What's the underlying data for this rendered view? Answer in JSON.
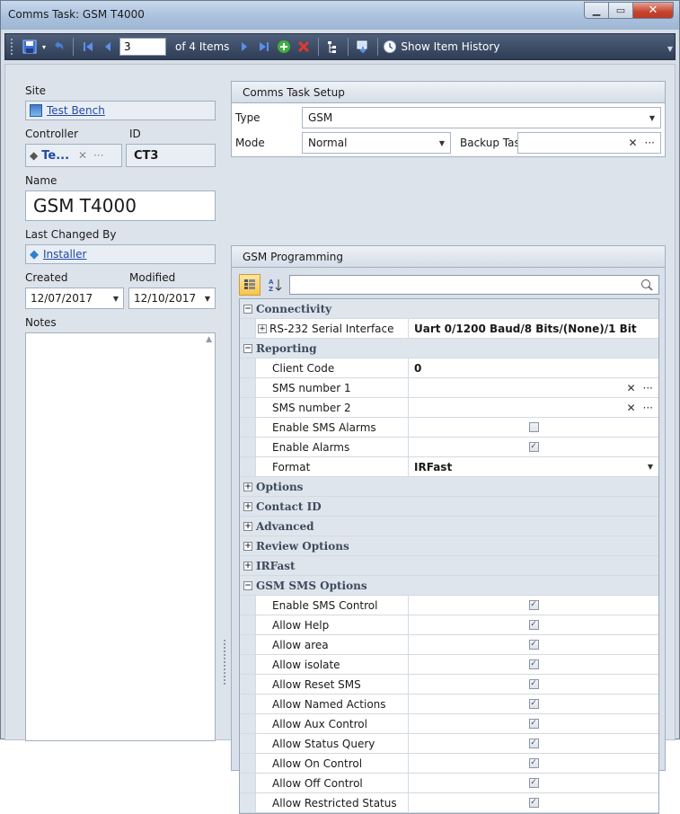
{
  "window": {
    "title": "Comms Task: GSM T4000",
    "controls": {
      "minimize": "▁",
      "maximize": "▭",
      "close": "✕"
    }
  },
  "toolbar": {
    "current_item": "3",
    "items_label": "of 4 Items",
    "history_label": "Show Item History",
    "icons": [
      "save-icon",
      "undo-icon",
      "first-icon",
      "prev-icon",
      "next-icon",
      "last-icon",
      "add-icon",
      "delete-icon",
      "tree-icon",
      "export-icon",
      "history-icon"
    ]
  },
  "left": {
    "site_label": "Site",
    "site_value": "Test Bench",
    "controller_label": "Controller",
    "controller_value": "Te...",
    "id_label": "ID",
    "id_value": "CT3",
    "name_label": "Name",
    "name_value": "GSM T4000",
    "last_changed_label": "Last Changed By",
    "last_changed_value": "Installer",
    "created_label": "Created",
    "created_value": "12/07/2017",
    "modified_label": "Modified",
    "modified_value": "12/10/2017",
    "notes_label": "Notes"
  },
  "setup": {
    "header": "Comms Task Setup",
    "type_label": "Type",
    "type_value": "GSM",
    "mode_label": "Mode",
    "mode_value": "Normal",
    "backup_label": "Backup Task",
    "backup_value": ""
  },
  "gsm": {
    "header": "GSM Programming",
    "cat_connectivity": "Connectivity",
    "rs232_name": "RS-232 Serial Interface",
    "rs232_value": "Uart 0/1200 Baud/8 Bits/(None)/1 Bit",
    "cat_reporting": "Reporting",
    "client_code_name": "Client Code",
    "client_code_value": "0",
    "sms1_name": "SMS number 1",
    "sms2_name": "SMS number 2",
    "enable_sms_alarms_name": "Enable SMS Alarms",
    "enable_alarms_name": "Enable Alarms",
    "format_name": "Format",
    "format_value": "IRFast",
    "cat_options": "Options",
    "cat_contact_id": "Contact ID",
    "cat_advanced": "Advanced",
    "cat_review": "Review Options",
    "cat_irfast": "IRFast",
    "cat_sms_options": "GSM SMS Options",
    "sms_options": [
      {
        "name": "Enable SMS Control",
        "checked": true
      },
      {
        "name": "Allow Help",
        "checked": true
      },
      {
        "name": "Allow area",
        "checked": true
      },
      {
        "name": "Allow isolate",
        "checked": true
      },
      {
        "name": "Allow Reset SMS",
        "checked": true
      },
      {
        "name": "Allow Named Actions",
        "checked": true
      },
      {
        "name": "Allow Aux Control",
        "checked": true
      },
      {
        "name": "Allow Status Query",
        "checked": true
      },
      {
        "name": "Allow On Control",
        "checked": true
      },
      {
        "name": "Allow Off Control",
        "checked": true
      },
      {
        "name": "Allow Restricted Status",
        "checked": true
      }
    ]
  },
  "colors": {
    "link": "#1f49a8",
    "toolbar_bg": "#3a4862",
    "category_text": "#3c4a5d"
  }
}
